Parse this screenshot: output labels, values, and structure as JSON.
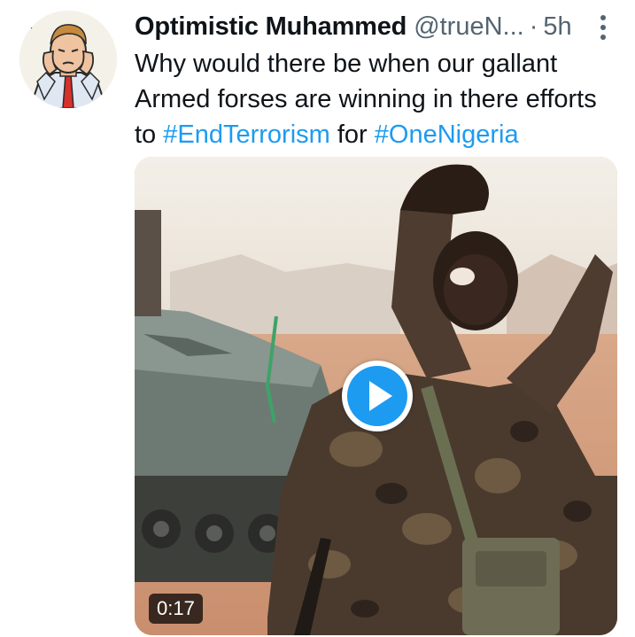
{
  "tweet": {
    "author_name": "Optimistic Muhammed",
    "handle": "@trueN...",
    "separator": "·",
    "time": "5h",
    "text_line1": "Why would there be when our gallant",
    "text_line2": "Armed forses are winning in there efforts",
    "text_line3_pre": "to ",
    "hashtag1": "#EndTerrorism",
    "text_line3_mid": " for ",
    "hashtag2": "#OneNigeria",
    "media": {
      "type": "video",
      "duration": "0:17"
    }
  },
  "icons": {
    "more": "more-vertical-icon",
    "play": "play-icon"
  },
  "colors": {
    "accent": "#1d9bf0",
    "text": "#0f1419",
    "secondary_text": "#536471"
  }
}
